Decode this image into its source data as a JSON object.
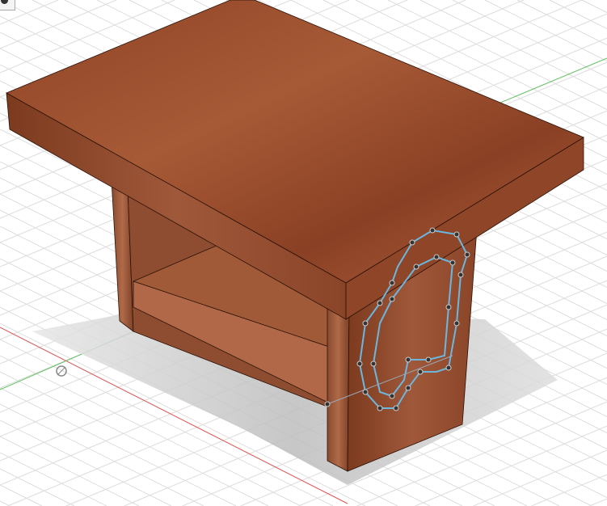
{
  "viewport": {
    "model": "table",
    "colors": {
      "grid": "#dcdcdc",
      "x_axis": "#e05050",
      "y_axis": "#60c060",
      "wood_top": "#9a4a2a",
      "wood_side": "#7a3a20",
      "wood_dark": "#5e2a14",
      "sketch": "#6ab8e0",
      "shadow": "#c8c8c8"
    }
  },
  "toolbar": {
    "icon": "view-cube-icon"
  }
}
